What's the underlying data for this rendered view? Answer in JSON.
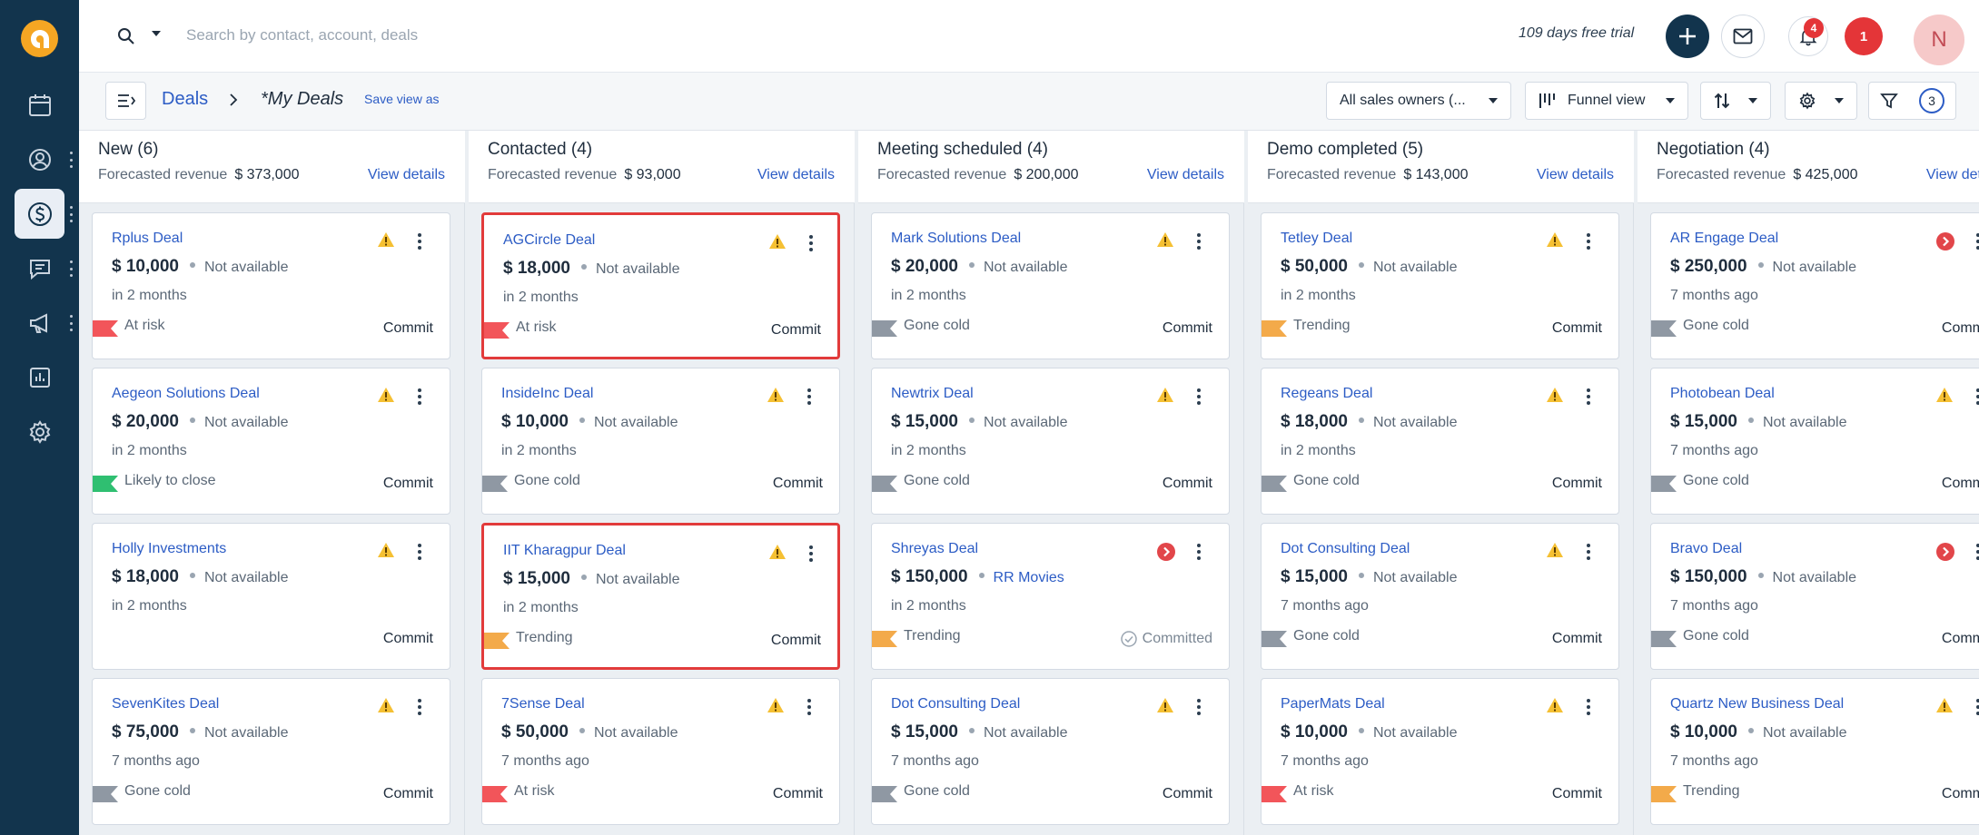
{
  "topbar": {
    "search_placeholder": "Search by contact, account, deals",
    "trial_text": "109 days free trial",
    "notification_count": "4",
    "alert_count": "1",
    "avatar_initial": "N"
  },
  "subheader": {
    "breadcrumb_root": "Deals",
    "view_name": "*My Deals",
    "save_view_label": "Save view as",
    "owners_filter": "All sales owners (...",
    "view_mode": "Funnel view",
    "filter_count": "3"
  },
  "forecast_label": "Forecasted revenue",
  "view_details_label": "View details",
  "columns": [
    {
      "title": "New (6)",
      "forecast": "$ 373,000",
      "cards": [
        {
          "title": "Rplus Deal",
          "amount": "$ 10,000",
          "sub": "Not available",
          "close": "in 2 months",
          "status": "At risk",
          "commit": "Commit",
          "icon": "warning"
        },
        {
          "title": "Aegeon Solutions Deal",
          "amount": "$ 20,000",
          "sub": "Not available",
          "close": "in 2 months",
          "status": "Likely to close",
          "commit": "Commit",
          "icon": "warning"
        },
        {
          "title": "Holly Investments",
          "amount": "$ 18,000",
          "sub": "Not available",
          "close": "in 2 months",
          "status": "",
          "commit": "Commit",
          "icon": "warning"
        },
        {
          "title": "SevenKites Deal",
          "amount": "$ 75,000",
          "sub": "Not available",
          "close": "7 months ago",
          "status": "Gone cold",
          "commit": "Commit",
          "icon": "warning"
        }
      ]
    },
    {
      "title": "Contacted (4)",
      "forecast": "$ 93,000",
      "cards": [
        {
          "title": "AGCircle Deal",
          "amount": "$ 18,000",
          "sub": "Not available",
          "close": "in 2 months",
          "status": "At risk",
          "commit": "Commit",
          "icon": "warning",
          "highlight": true
        },
        {
          "title": "InsideInc Deal",
          "amount": "$ 10,000",
          "sub": "Not available",
          "close": "in 2 months",
          "status": "Gone cold",
          "commit": "Commit",
          "icon": "warning"
        },
        {
          "title": "IIT Kharagpur Deal",
          "amount": "$ 15,000",
          "sub": "Not available",
          "close": "in 2 months",
          "status": "Trending",
          "commit": "Commit",
          "icon": "warning",
          "highlight": true
        },
        {
          "title": "7Sense Deal",
          "amount": "$ 50,000",
          "sub": "Not available",
          "close": "7 months ago",
          "status": "At risk",
          "commit": "Commit",
          "icon": "warning"
        }
      ]
    },
    {
      "title": "Meeting scheduled (4)",
      "forecast": "$ 200,000",
      "cards": [
        {
          "title": "Mark Solutions Deal",
          "amount": "$ 20,000",
          "sub": "Not available",
          "close": "in 2 months",
          "status": "Gone cold",
          "commit": "Commit",
          "icon": "warning"
        },
        {
          "title": "Newtrix Deal",
          "amount": "$ 15,000",
          "sub": "Not available",
          "close": "in 2 months",
          "status": "Gone cold",
          "commit": "Commit",
          "icon": "warning"
        },
        {
          "title": "Shreyas Deal",
          "amount": "$ 150,000",
          "sub": "RR Movies",
          "sub_link": true,
          "close": "in 2 months",
          "status": "Trending",
          "commit": "Committed",
          "committed": true,
          "icon": "overdue"
        },
        {
          "title": "Dot Consulting Deal",
          "amount": "$ 15,000",
          "sub": "Not available",
          "close": "7 months ago",
          "status": "Gone cold",
          "commit": "Commit",
          "icon": "warning"
        }
      ]
    },
    {
      "title": "Demo completed (5)",
      "forecast": "$ 143,000",
      "cards": [
        {
          "title": "Tetley Deal",
          "amount": "$ 50,000",
          "sub": "Not available",
          "close": "in 2 months",
          "status": "Trending",
          "commit": "Commit",
          "icon": "warning"
        },
        {
          "title": "Regeans Deal",
          "amount": "$ 18,000",
          "sub": "Not available",
          "close": "in 2 months",
          "status": "Gone cold",
          "commit": "Commit",
          "icon": "warning"
        },
        {
          "title": "Dot Consulting Deal",
          "amount": "$ 15,000",
          "sub": "Not available",
          "close": "7 months ago",
          "status": "Gone cold",
          "commit": "Commit",
          "icon": "warning"
        },
        {
          "title": "PaperMats Deal",
          "amount": "$ 10,000",
          "sub": "Not available",
          "close": "7 months ago",
          "status": "At risk",
          "commit": "Commit",
          "icon": "warning"
        }
      ]
    },
    {
      "title": "Negotiation (4)",
      "forecast": "$ 425,000",
      "cards": [
        {
          "title": "AR Engage Deal",
          "amount": "$ 250,000",
          "sub": "Not available",
          "close": "7 months ago",
          "status": "Gone cold",
          "commit": "Commit",
          "icon": "overdue"
        },
        {
          "title": "Photobean Deal",
          "amount": "$ 15,000",
          "sub": "Not available",
          "close": "7 months ago",
          "status": "Gone cold",
          "commit": "Commit",
          "icon": "warning"
        },
        {
          "title": "Bravo Deal",
          "amount": "$ 150,000",
          "sub": "Not available",
          "close": "7 months ago",
          "status": "Gone cold",
          "commit": "Commit",
          "icon": "overdue"
        },
        {
          "title": "Quartz New Business Deal",
          "amount": "$ 10,000",
          "sub": "Not available",
          "close": "7 months ago",
          "status": "Trending",
          "commit": "Commit",
          "icon": "warning"
        }
      ]
    }
  ],
  "status_colors": {
    "At risk": "#f2555a",
    "Likely to close": "#2fbf71",
    "Gone cold": "#8f98a3",
    "Trending": "#f3aa4a"
  }
}
